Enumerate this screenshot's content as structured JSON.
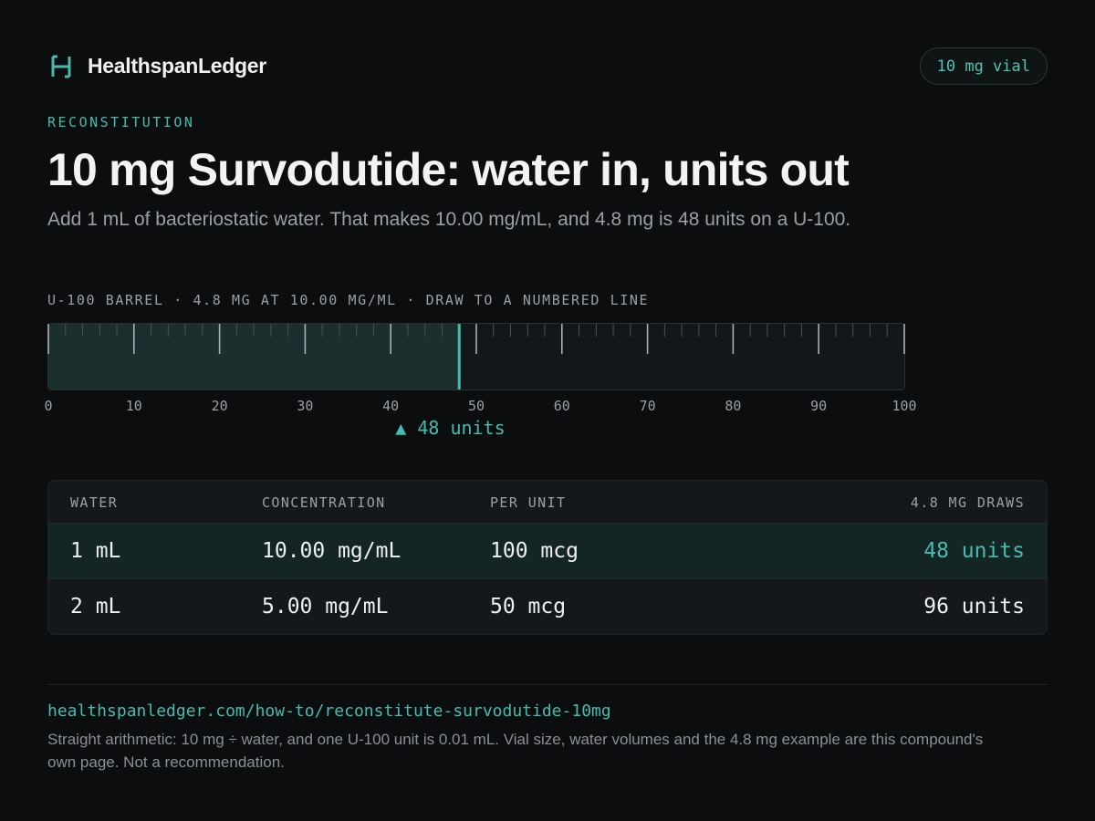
{
  "brand": {
    "name": "HealthspanLedger",
    "logo_icon": "h-bracket-logo-icon"
  },
  "vial_badge": "10 mg vial",
  "eyebrow": "RECONSTITUTION",
  "title": "10 mg Survodutide: water in, units out",
  "subtitle": "Add 1 mL of bacteriostatic water. That makes 10.00 mg/mL, and 4.8 mg is 48 units on a U-100.",
  "barrel": {
    "label": "U-100 BARREL · 4.8 MG AT 10.00 MG/ML · DRAW TO A NUMBERED LINE",
    "max_units": 100,
    "fill_units": 48,
    "tick_labels": [
      "0",
      "10",
      "20",
      "30",
      "40",
      "50",
      "60",
      "70",
      "80",
      "90",
      "100"
    ],
    "pointer_label": "▲ 48 units"
  },
  "table": {
    "headers": [
      "WATER",
      "CONCENTRATION",
      "PER UNIT",
      "4.8 MG DRAWS"
    ],
    "rows": [
      {
        "water": "1 mL",
        "concentration": "10.00 mg/mL",
        "per_unit": "100 mcg",
        "draws": "48 units",
        "highlighted": true
      },
      {
        "water": "2 mL",
        "concentration": "5.00 mg/mL",
        "per_unit": "50 mcg",
        "draws": "96 units",
        "highlighted": false
      }
    ]
  },
  "footer": {
    "url": "healthspanledger.com/how-to/reconstitute-survodutide-10mg",
    "note": "Straight arithmetic: 10 mg ÷ water, and one U-100 unit is 0.01 mL. Vial size, water volumes and the 4.8 mg example are this compound's own page. Not a recommendation."
  },
  "colors": {
    "accent": "#45bcae",
    "background": "#0b0d0f",
    "fill": "#1b2f2f"
  }
}
